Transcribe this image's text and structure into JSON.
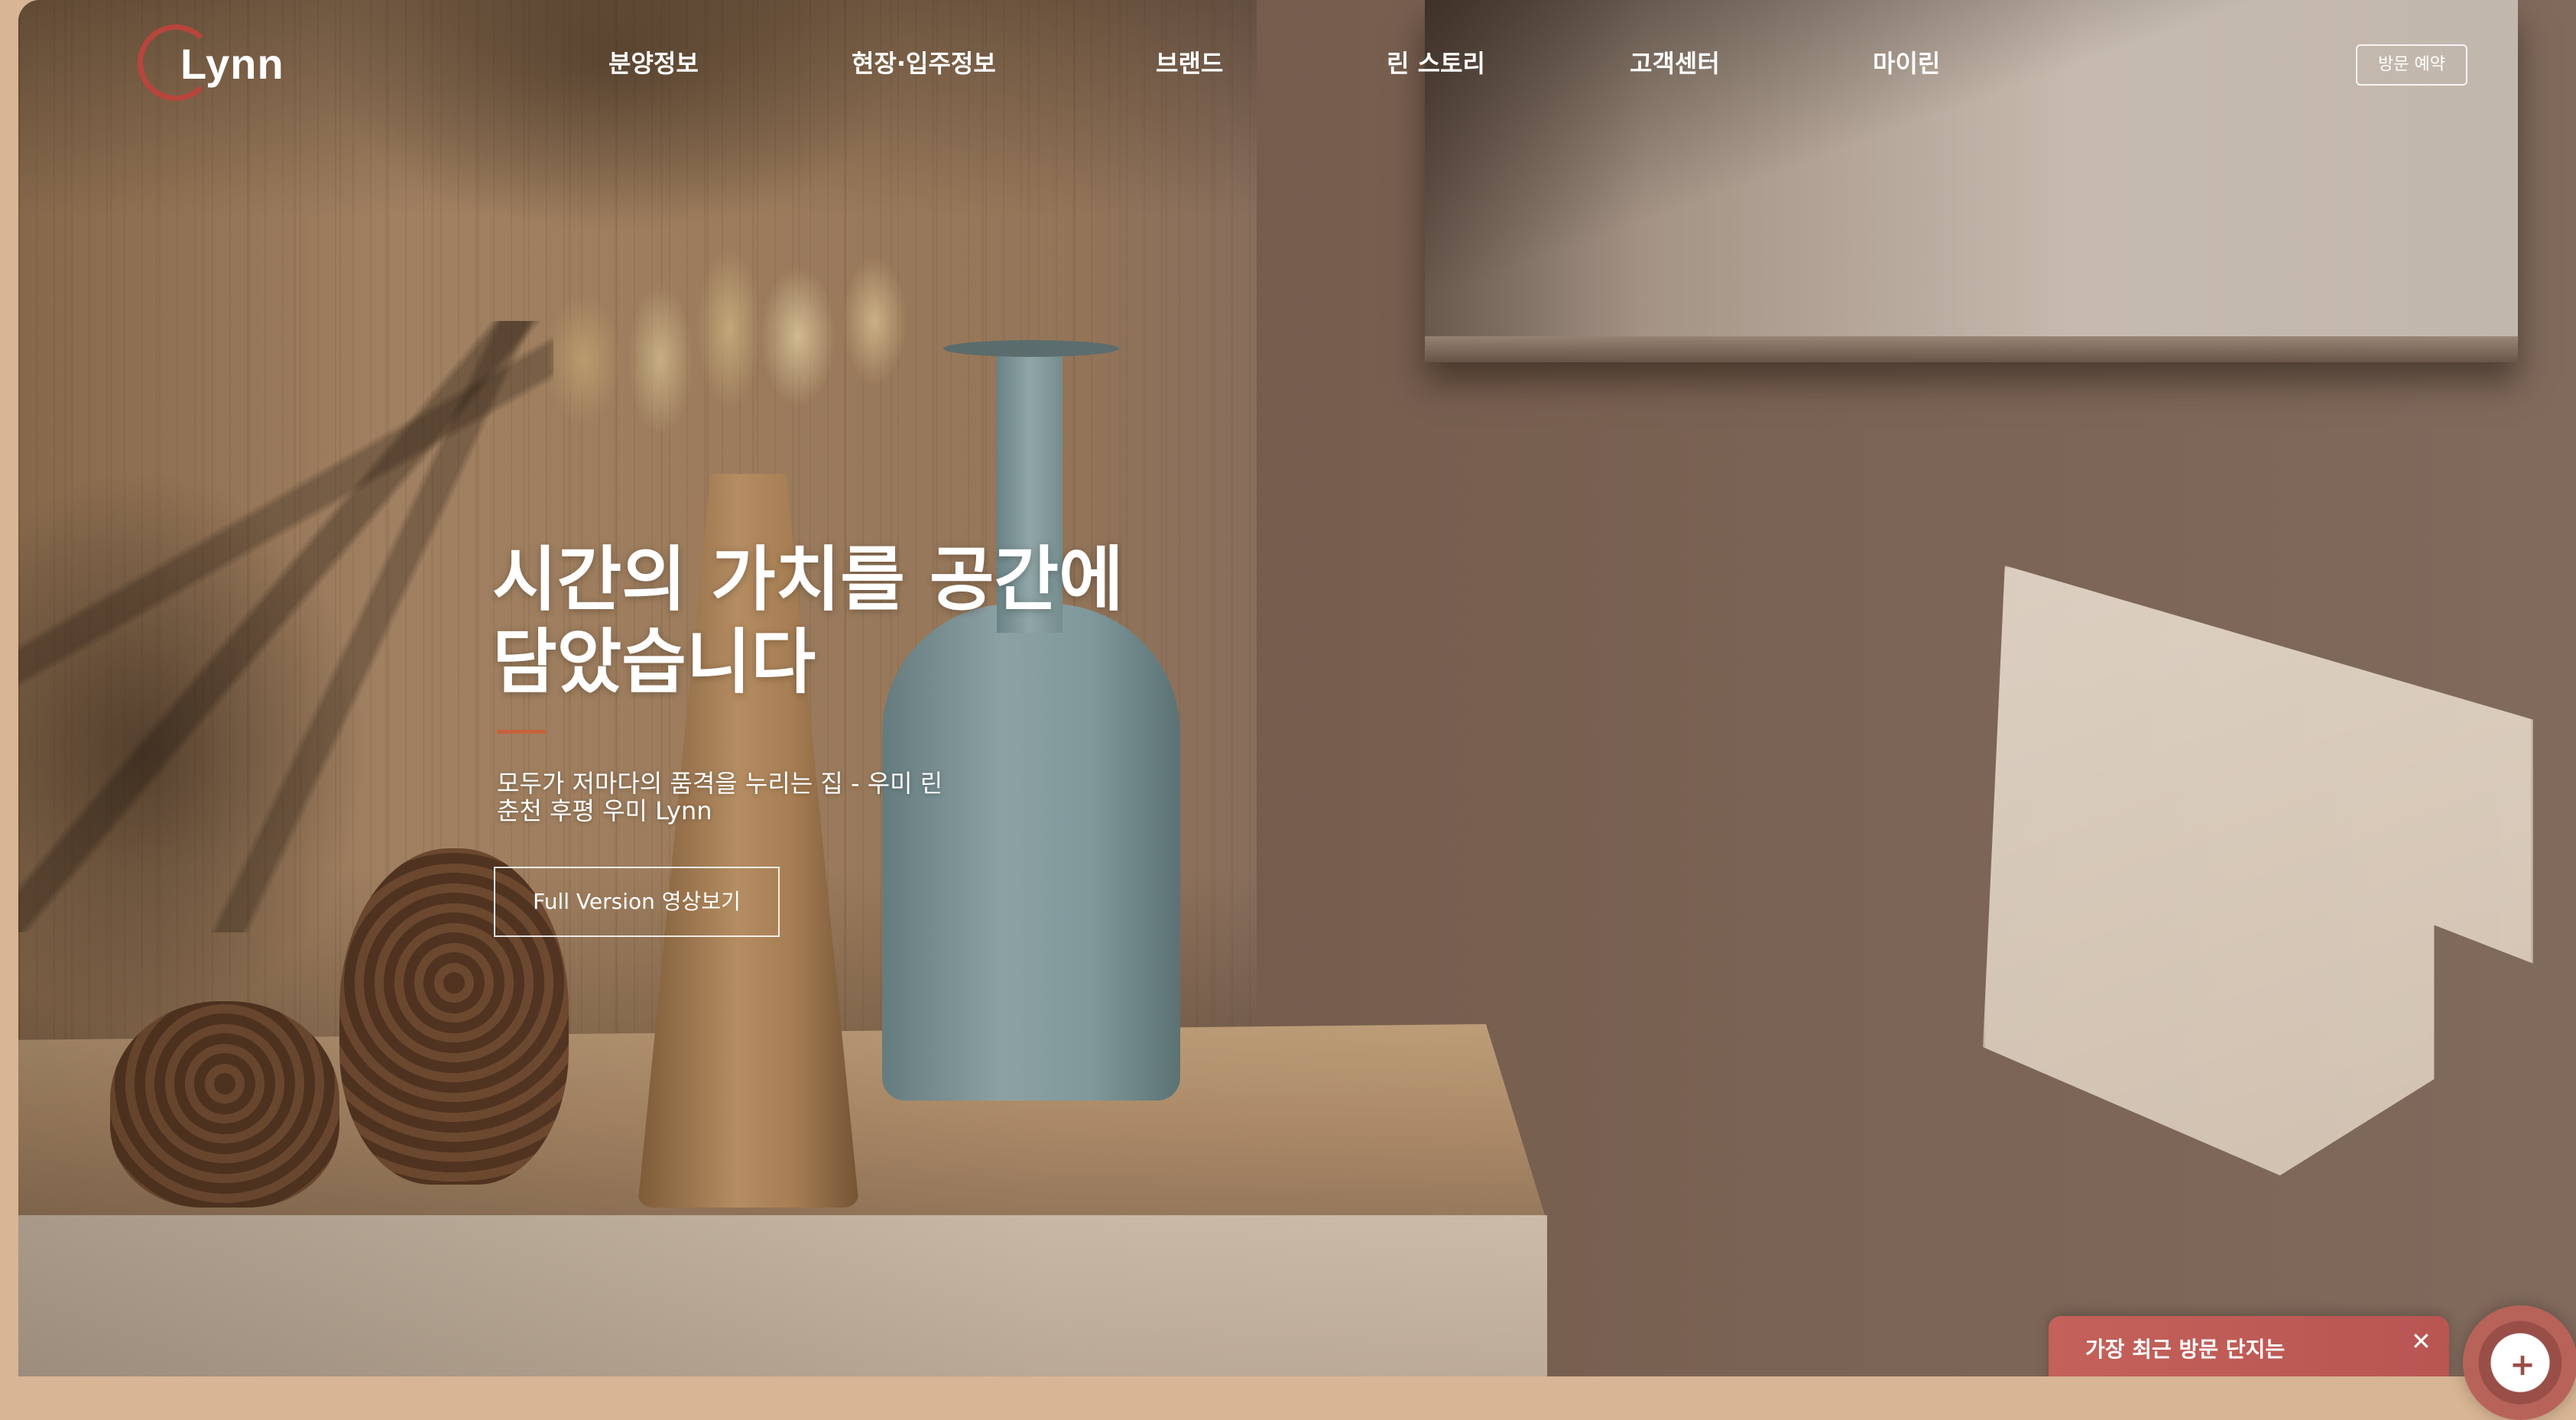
{
  "brand": {
    "logo_text": "Lynn",
    "logo_ring_color": "#b8453c"
  },
  "nav": {
    "items": [
      {
        "label": "분양정보"
      },
      {
        "label": "현장·입주정보"
      },
      {
        "label": "브랜드"
      },
      {
        "label": "린 스토리"
      },
      {
        "label": "고객센터"
      },
      {
        "label": "마이린"
      }
    ],
    "visit_button": "방문 예약"
  },
  "hero": {
    "title_line1": "시간의 가치를 공간에",
    "title_line2": "담았습니다",
    "subtitle_line1": "모두가 저마다의 품격을 누리는 집 - 우미 린",
    "subtitle_line2": "춘천 후평 우미 Lynn",
    "video_button": "Full Version 영상보기",
    "accent_color": "#c6623b"
  },
  "toast": {
    "title": "가장 최근 방문 단지는",
    "line2": "",
    "close_icon": "close-icon"
  },
  "fab": {
    "icon": "plus-icon"
  }
}
